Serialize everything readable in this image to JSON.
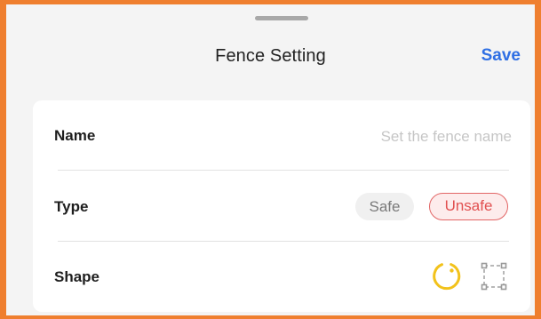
{
  "header": {
    "title": "Fence Setting",
    "save_label": "Save"
  },
  "form": {
    "name": {
      "label": "Name",
      "value": "",
      "placeholder": "Set the fence name"
    },
    "type": {
      "label": "Type",
      "options": [
        "Safe",
        "Unsafe"
      ],
      "selected": "Unsafe"
    },
    "shape": {
      "label": "Shape",
      "options": [
        "circle-icon",
        "rectangle-icon"
      ],
      "selected": "circle-icon"
    }
  },
  "colors": {
    "accent": "#2f6fe4",
    "unsafe": "#e15050",
    "circle_selected": "#f2c21b",
    "frame": "#ef7f2f"
  }
}
